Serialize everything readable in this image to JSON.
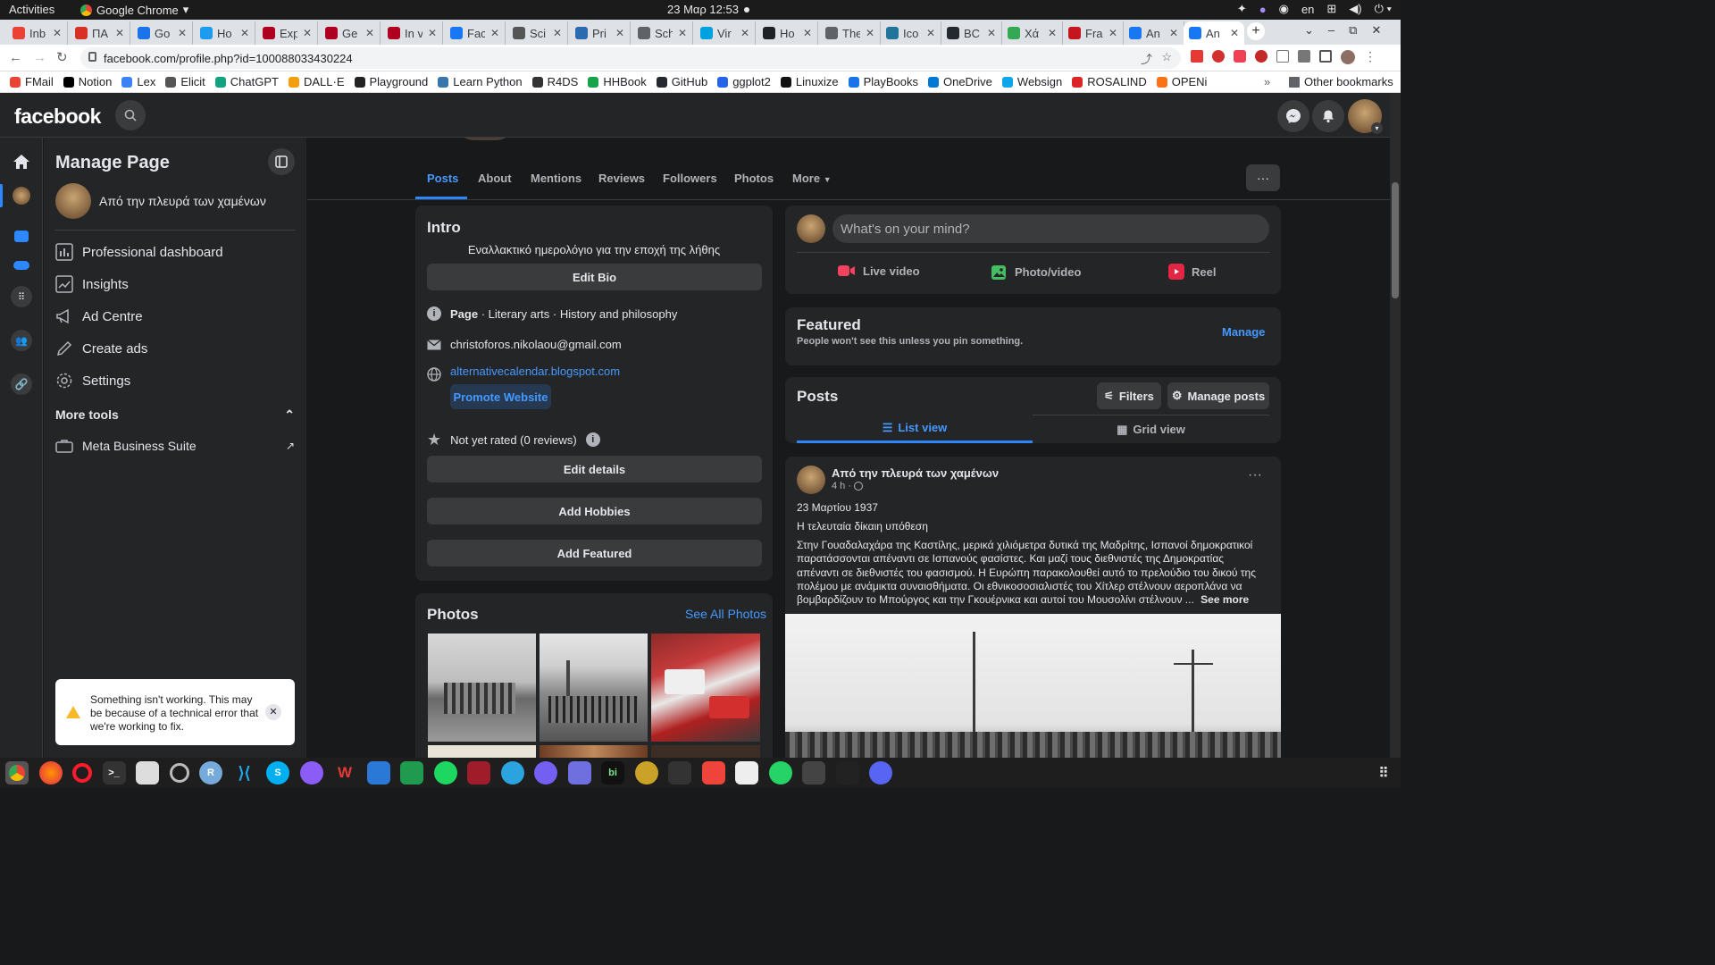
{
  "system": {
    "activities": "Activities",
    "app_name": "Google Chrome",
    "clock": "23 Μαρ  12:53",
    "lang": "en"
  },
  "tabs": [
    {
      "label": "Inb",
      "color": "#ea4335"
    },
    {
      "label": "ΠΑ",
      "color": "#d93025"
    },
    {
      "label": "Go",
      "color": "#1a73e8"
    },
    {
      "label": "Ho",
      "color": "#1d9bf0"
    },
    {
      "label": "Exp",
      "color": "#b00020"
    },
    {
      "label": "Ge",
      "color": "#b00020"
    },
    {
      "label": "In v",
      "color": "#b00020"
    },
    {
      "label": "Fac",
      "color": "#1877f2"
    },
    {
      "label": "Sci",
      "color": "#555555"
    },
    {
      "label": "Pri",
      "color": "#2b6cb0"
    },
    {
      "label": "Sch",
      "color": "#5f6368"
    },
    {
      "label": "Vir",
      "color": "#00a1e0"
    },
    {
      "label": "Ho",
      "color": "#202124"
    },
    {
      "label": "The",
      "color": "#5f6368"
    },
    {
      "label": "Ico",
      "color": "#21759b"
    },
    {
      "label": "BC",
      "color": "#24292f"
    },
    {
      "label": "Χά",
      "color": "#34a853"
    },
    {
      "label": "Fra",
      "color": "#c4161c"
    },
    {
      "label": "An",
      "color": "#1877f2"
    },
    {
      "label": "An",
      "color": "#1877f2"
    }
  ],
  "url": "facebook.com/profile.php?id=100088033430224",
  "bookmarks": [
    {
      "label": "FMail",
      "color": "#ea4335"
    },
    {
      "label": "Notion",
      "color": "#000000"
    },
    {
      "label": "Lex",
      "color": "#3b82f6"
    },
    {
      "label": "Elicit",
      "color": "#555555"
    },
    {
      "label": "ChatGPT",
      "color": "#10a37f"
    },
    {
      "label": "DALL·E",
      "color": "#f59e0b"
    },
    {
      "label": "Playground",
      "color": "#222222"
    },
    {
      "label": "Learn Python",
      "color": "#3776ab"
    },
    {
      "label": "R4DS",
      "color": "#333333"
    },
    {
      "label": "HHBook",
      "color": "#16a34a"
    },
    {
      "label": "GitHub",
      "color": "#24292f"
    },
    {
      "label": "ggplot2",
      "color": "#2563eb"
    },
    {
      "label": "Linuxize",
      "color": "#111111"
    },
    {
      "label": "PlayBooks",
      "color": "#1a73e8"
    },
    {
      "label": "OneDrive",
      "color": "#0078d4"
    },
    {
      "label": "Websign",
      "color": "#0ea5e9"
    },
    {
      "label": "ROSALIND",
      "color": "#dc2626"
    },
    {
      "label": "OPENi",
      "color": "#f97316"
    }
  ],
  "other_bookmarks": "Other bookmarks",
  "fb": {
    "logo": "facebook",
    "manage_title": "Manage Page",
    "page_name": "Από την πλευρά των χαμένων",
    "menu": [
      {
        "label": "Professional dashboard",
        "icon": "dashboard-icon"
      },
      {
        "label": "Insights",
        "icon": "insights-icon"
      },
      {
        "label": "Ad Centre",
        "icon": "megaphone-icon"
      },
      {
        "label": "Create ads",
        "icon": "pencil-icon"
      },
      {
        "label": "Settings",
        "icon": "gear-icon"
      }
    ],
    "more_tools": "More tools",
    "meta_suite": "Meta Business Suite",
    "error_toast": "Something isn't working. This may be because of a technical error that we're working to fix.",
    "profile_tabs": [
      "Posts",
      "About",
      "Mentions",
      "Reviews",
      "Followers",
      "Photos"
    ],
    "more_tab": "More",
    "intro": {
      "title": "Intro",
      "bio": "Εναλλακτικό ημερολόγιο για την εποχή της λήθης",
      "edit_bio": "Edit Bio",
      "page_label": "Page",
      "category": " · Literary arts · History and philosophy",
      "email": "christoforos.nikolaou@gmail.com",
      "website": "alternativecalendar.blogspot.com",
      "promote": "Promote Website",
      "rating": "Not yet rated (0 reviews)",
      "edit_details": "Edit details",
      "add_hobbies": "Add Hobbies",
      "add_featured": "Add Featured"
    },
    "photos": {
      "title": "Photos",
      "see_all": "See All Photos"
    },
    "composer": {
      "placeholder": "What's on your mind?",
      "live": "Live video",
      "photo": "Photo/video",
      "reel": "Reel"
    },
    "featured": {
      "title": "Featured",
      "subtitle": "People won't see this unless you pin something.",
      "manage": "Manage"
    },
    "posts_header": {
      "title": "Posts",
      "filters": "Filters",
      "manage_posts": "Manage posts",
      "list_view": "List view",
      "grid_view": "Grid view"
    },
    "post": {
      "author": "Από την πλευρά των χαμένων",
      "time": "4 h ·",
      "date_line": "23 Μαρτίου 1937",
      "headline": "Η τελευταία δίκαιη υπόθεση",
      "body": "Στην Γουαδαλαχάρα της Καστίλης, μερικά χιλιόμετρα δυτικά της Μαδρίτης, Ισπανοί δημοκρατικοί παρατάσσονται απέναντι σε Ισπανούς φασίστες. Και μαζί τους διεθνιστές της Δημοκρατίας απέναντι σε διεθνιστές του φασισμού. Η Ευρώπη παρακολουθεί αυτό  το πρελούδιο του δικού της πολέμου με ανάμικτα συναισθήματα. Οι εθνικοσοσιαλιστές του Χίτλερ στέλνουν αεροπλάνα να βομβαρδίζουν το Μπούργος και την Γκουέρνικα και αυτοί του Μουσολίνι στέλνουν ...",
      "see_more": "See more"
    }
  },
  "colors": {
    "fb_blue": "#2d88ff",
    "link": "#4599ff",
    "warning": "#f7b928"
  }
}
